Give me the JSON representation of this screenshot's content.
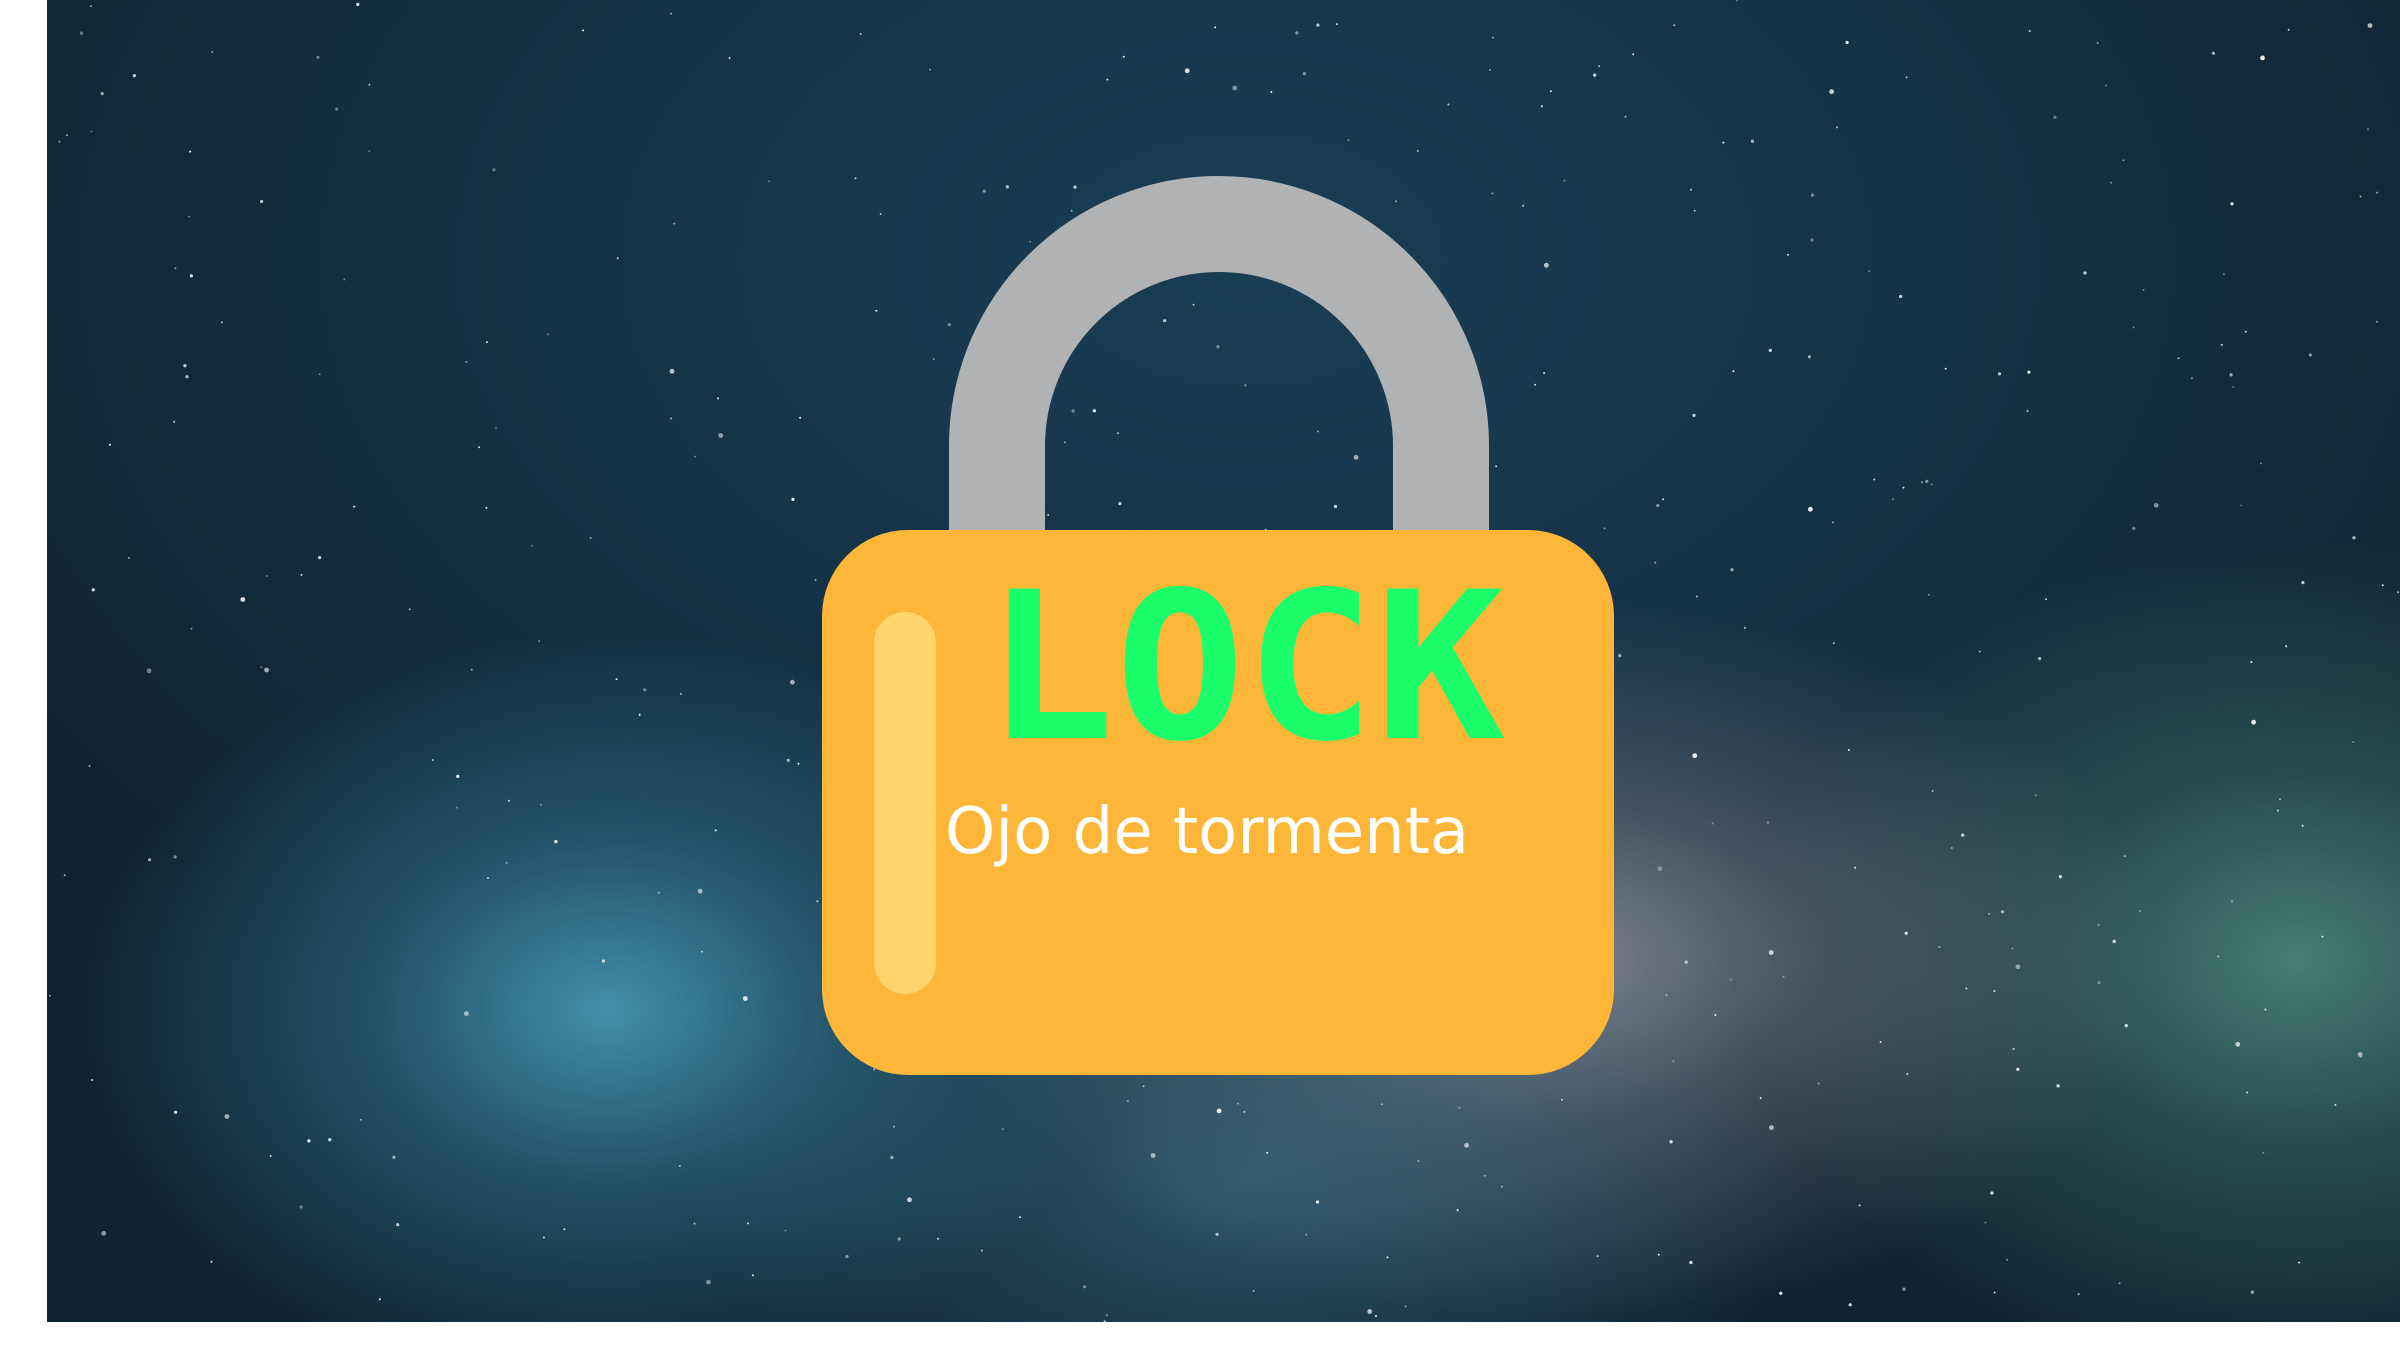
{
  "scene": {
    "background": "starry night sky",
    "icon": "padlock-icon"
  },
  "lock": {
    "title": "LOCK",
    "subtitle": "Ojo de tormenta"
  },
  "colors": {
    "shackle": "#b0b2b3",
    "body": "#fdb637",
    "highlight": "#ffd46d",
    "title": "#1afe69",
    "subtitle": "#ffffff",
    "sky_dark": "#0f2433"
  }
}
